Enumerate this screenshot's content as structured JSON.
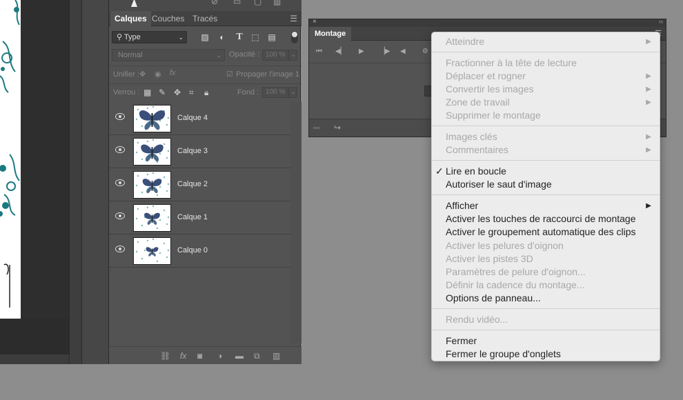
{
  "layers_panel": {
    "tabs": [
      "Calques",
      "Couches",
      "Tracés"
    ],
    "filter": {
      "label": "Type"
    },
    "blend_mode": "Normal",
    "opacity_label": "Opacité :",
    "opacity_value": "100 %",
    "unify_label": "Unifier :",
    "propagate_label": "Propager l'image 1",
    "lock_label": "Verrou :",
    "fill_label": "Fond :",
    "fill_value": "100 %",
    "layers": [
      {
        "name": "Calque 4",
        "visible": true
      },
      {
        "name": "Calque 3",
        "visible": true
      },
      {
        "name": "Calque 2",
        "visible": true
      },
      {
        "name": "Calque 1",
        "visible": true
      },
      {
        "name": "Calque 0",
        "visible": true
      }
    ],
    "bottom_icons": [
      "link-icon",
      "fx-icon",
      "mask-icon",
      "adjustment-icon",
      "folder-icon",
      "new-layer-icon",
      "trash-icon"
    ]
  },
  "montage_panel": {
    "tab_label": "Montage",
    "controls": [
      "first-frame-icon",
      "prev-frame-icon",
      "play-icon",
      "next-frame-icon",
      "audio-icon",
      "settings-icon"
    ]
  },
  "context_menu": {
    "items": [
      {
        "label": "Atteindre",
        "disabled": true,
        "submenu": true
      },
      {
        "separator": true
      },
      {
        "label": "Fractionner à la tête de lecture",
        "disabled": true
      },
      {
        "label": "Déplacer et rogner",
        "disabled": true,
        "submenu": true
      },
      {
        "label": "Convertir les images",
        "disabled": true,
        "submenu": true
      },
      {
        "label": "Zone de travail",
        "disabled": true,
        "submenu": true
      },
      {
        "label": "Supprimer le montage",
        "disabled": true
      },
      {
        "separator": true
      },
      {
        "label": "Images clés",
        "disabled": true,
        "submenu": true
      },
      {
        "label": "Commentaires",
        "disabled": true,
        "submenu": true
      },
      {
        "separator": true
      },
      {
        "label": "Lire en boucle",
        "checked": true
      },
      {
        "label": "Autoriser le saut d'image"
      },
      {
        "separator": true
      },
      {
        "label": "Afficher",
        "submenu": true
      },
      {
        "label": "Activer les touches de raccourci de montage"
      },
      {
        "label": "Activer le groupement automatique des clips"
      },
      {
        "label": "Activer les pelures d'oignon",
        "disabled": true
      },
      {
        "label": "Activer les pistes 3D",
        "disabled": true
      },
      {
        "label": "Paramètres de pelure d'oignon...",
        "disabled": true
      },
      {
        "label": "Définir la cadence du montage...",
        "disabled": true
      },
      {
        "label": "Options de panneau..."
      },
      {
        "separator": true
      },
      {
        "label": "Rendu vidéo...",
        "disabled": true
      },
      {
        "separator": true
      },
      {
        "label": "Fermer"
      },
      {
        "label": "Fermer le groupe d'onglets"
      }
    ]
  },
  "colors": {
    "panel_bg": "#535353",
    "menu_bg": "#ececec",
    "accent_teal": "#1b7a80",
    "desktop_bg": "#8d8d8d"
  }
}
